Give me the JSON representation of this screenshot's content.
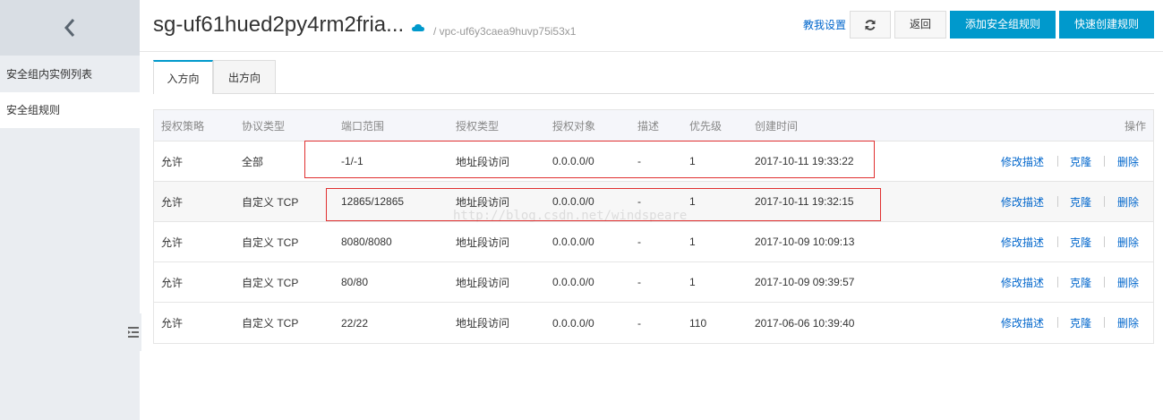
{
  "sidebar": {
    "back_icon": "chevron-left-icon",
    "items": [
      {
        "label": "安全组内实例列表"
      },
      {
        "label": "安全组规则"
      }
    ],
    "collapse_icon": "collapse-icon"
  },
  "header": {
    "title": "sg-uf61hued2py4rm2fria...",
    "vpc": "/ vpc-uf6y3caea9huvp75i53x1",
    "help": "教我设置",
    "back": "返回",
    "add": "添加安全组规则",
    "quick": "快速创建规则",
    "accent": "#0099cc"
  },
  "tabs": [
    {
      "label": "入方向"
    },
    {
      "label": "出方向"
    }
  ],
  "table": {
    "headers": [
      "授权策略",
      "协议类型",
      "端口范围",
      "授权类型",
      "授权对象",
      "描述",
      "优先级",
      "创建时间",
      "操作"
    ],
    "rows": [
      {
        "policy": "允许",
        "protocol": "全部",
        "port": "-1/-1",
        "auth_type": "地址段访问",
        "target": "0.0.0.0/0",
        "desc": "-",
        "priority": "1",
        "created": "2017-10-11 19:33:22"
      },
      {
        "policy": "允许",
        "protocol": "自定义 TCP",
        "port": "12865/12865",
        "auth_type": "地址段访问",
        "target": "0.0.0.0/0",
        "desc": "-",
        "priority": "1",
        "created": "2017-10-11 19:32:15"
      },
      {
        "policy": "允许",
        "protocol": "自定义 TCP",
        "port": "8080/8080",
        "auth_type": "地址段访问",
        "target": "0.0.0.0/0",
        "desc": "-",
        "priority": "1",
        "created": "2017-10-09 10:09:13"
      },
      {
        "policy": "允许",
        "protocol": "自定义 TCP",
        "port": "80/80",
        "auth_type": "地址段访问",
        "target": "0.0.0.0/0",
        "desc": "-",
        "priority": "1",
        "created": "2017-10-09 09:39:57"
      },
      {
        "policy": "允许",
        "protocol": "自定义 TCP",
        "port": "22/22",
        "auth_type": "地址段访问",
        "target": "0.0.0.0/0",
        "desc": "-",
        "priority": "110",
        "created": "2017-06-06 10:39:40"
      }
    ],
    "actions": [
      "修改描述",
      "克隆",
      "删除"
    ]
  },
  "watermark": "http://blog.csdn.net/windspeare"
}
